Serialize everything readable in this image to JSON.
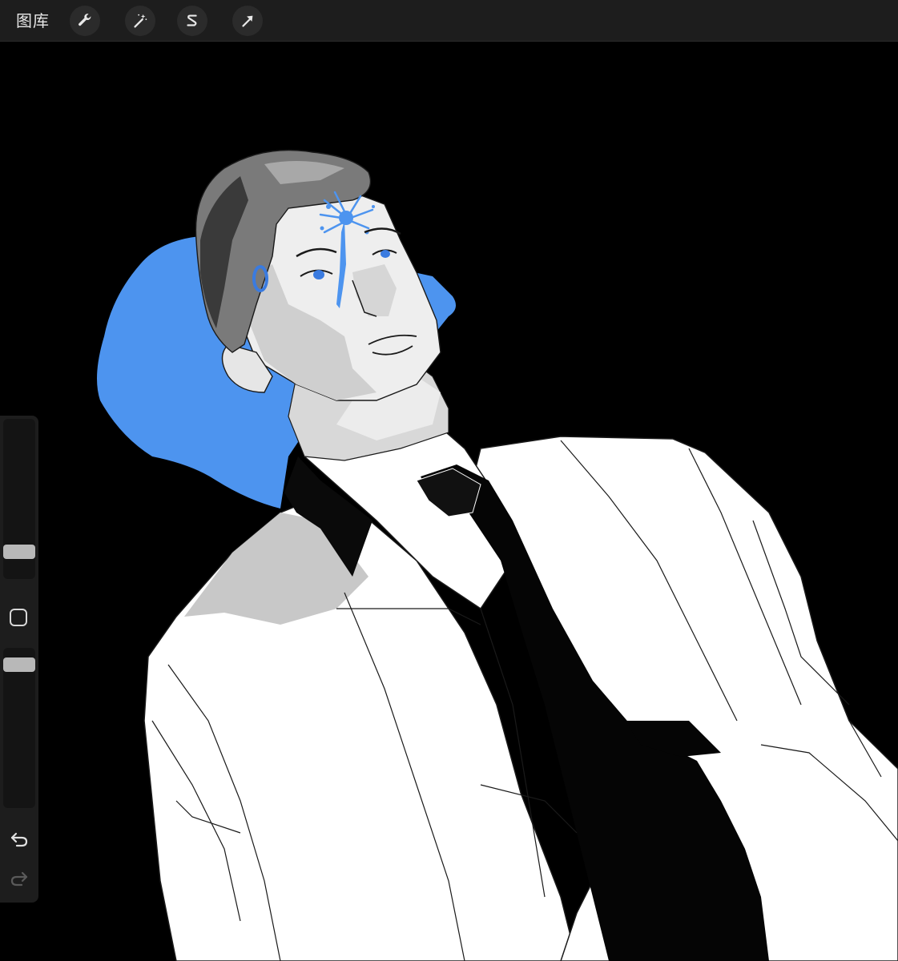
{
  "toolbar": {
    "gallery_label": "图库",
    "tools": [
      {
        "icon": "wrench-icon",
        "name": "actions"
      },
      {
        "icon": "magic-wand-icon",
        "name": "adjustments"
      },
      {
        "icon": "selection-s-icon",
        "name": "selection"
      },
      {
        "icon": "arrow-cursor-icon",
        "name": "transform"
      }
    ]
  },
  "sidebar": {
    "brush_size_level": 0.2,
    "opacity_level": 0.9,
    "undo_icon": "undo-icon",
    "redo_icon": "redo-icon"
  },
  "colors": {
    "toolbar_bg": "#1d1d1d",
    "canvas_bg": "#000000",
    "accent_blue": "#4d94ef",
    "eye_blue": "#3a7be0"
  }
}
